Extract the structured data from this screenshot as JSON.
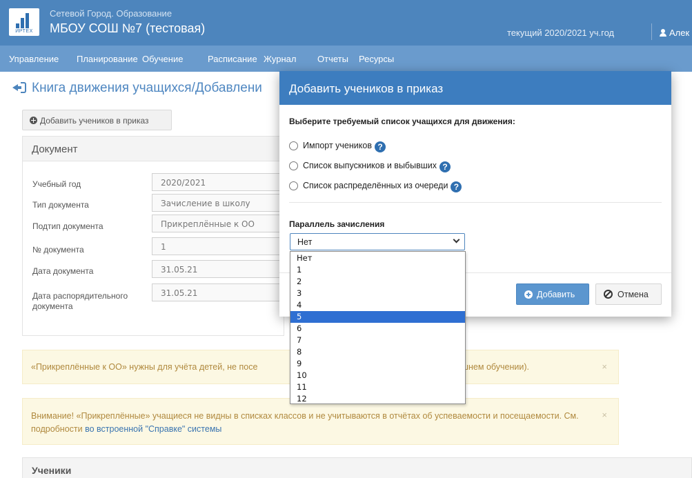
{
  "header": {
    "logo_text": "ИРТЕХ",
    "app_name": "Сетевой Город. Образование",
    "school_name": "МБОУ СОШ №7 (тестовая)",
    "current_year": "текущий 2020/2021 уч.год",
    "user_name": "Алек"
  },
  "nav": [
    "Управление",
    "Планирование",
    "Обучение",
    "Расписание",
    "Журнал",
    "Отчеты",
    "Ресурсы"
  ],
  "breadcrumb": "Книга движения учащихся/Добавлени",
  "add_students_button": "Добавить учеников в приказ",
  "document": {
    "title": "Документ",
    "fields": [
      {
        "label": "Учебный год",
        "value": "2020/2021"
      },
      {
        "label": "Тип документа",
        "value": "Зачисление в школу"
      },
      {
        "label": "Подтип документа",
        "value": "Прикреплённые к ОО"
      },
      {
        "label": "№ документа",
        "value": "1"
      },
      {
        "label": "Дата документа",
        "value": "31.05.21"
      },
      {
        "label": "Дата распорядительного документа",
        "value": "31.05.21"
      }
    ]
  },
  "alerts": {
    "first_left": "«Прикреплённые к ОО» нужны для учёта детей, не посе",
    "first_right": "шнем обучении).",
    "second_text": "Внимание! «Прикреплённые» учащиеся не видны в списках классов и не учитываются в отчётах об успеваемости и посещаемости. См. подробности ",
    "second_link": "во встроенной \"Справке\" системы",
    "close": "×"
  },
  "pupils_title": "Ученики",
  "modal": {
    "title": "Добавить учеников в приказ",
    "question": "Выберите требуемый список учащихся для движения:",
    "options": [
      "Импорт учеников",
      "Список выпускников и выбывших",
      "Список распределённых из очереди"
    ],
    "help_glyph": "?",
    "parallel_label": "Параллель зачисления",
    "select_value": "Нет",
    "add_button": "Добавить",
    "cancel_button": "Отмена"
  },
  "dropdown": {
    "options": [
      "Нет",
      "1",
      "2",
      "3",
      "4",
      "5",
      "6",
      "7",
      "8",
      "9",
      "10",
      "11",
      "12"
    ],
    "selected": "5"
  },
  "colors": {
    "header": "#4d85bd",
    "nav": "#6a9bcd",
    "modal_header": "#3d7dbf",
    "alert_bg": "#fcf8e3",
    "selected_option": "#2f6fd2"
  }
}
